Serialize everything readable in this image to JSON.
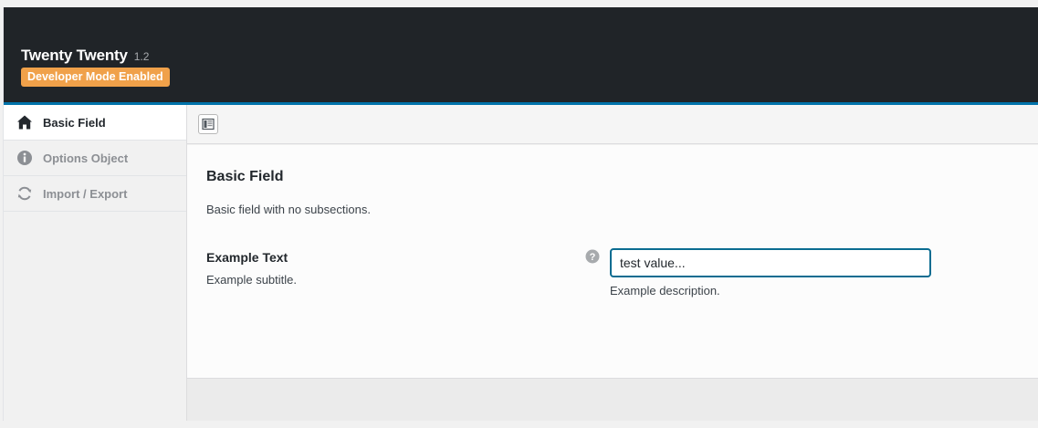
{
  "header": {
    "theme_name": "Twenty Twenty",
    "theme_version": "1.2",
    "dev_badge": "Developer Mode Enabled"
  },
  "colors": {
    "header_bg": "#202428",
    "accent_blue": "#0073aa",
    "badge_orange": "#f0a14a"
  },
  "sidebar": {
    "items": [
      {
        "label": "Basic Field",
        "icon": "home-icon",
        "active": true
      },
      {
        "label": "Options Object",
        "icon": "info-icon",
        "active": false
      },
      {
        "label": "Import / Export",
        "icon": "refresh-icon",
        "active": false
      }
    ]
  },
  "toolbar": {
    "toggle_icon": "layout-toggle-icon"
  },
  "section": {
    "title": "Basic Field",
    "description": "Basic field with no subsections."
  },
  "field": {
    "title": "Example Text",
    "subtitle": "Example subtitle.",
    "value": "test value...",
    "description": "Example description.",
    "help_icon": "question-icon"
  }
}
